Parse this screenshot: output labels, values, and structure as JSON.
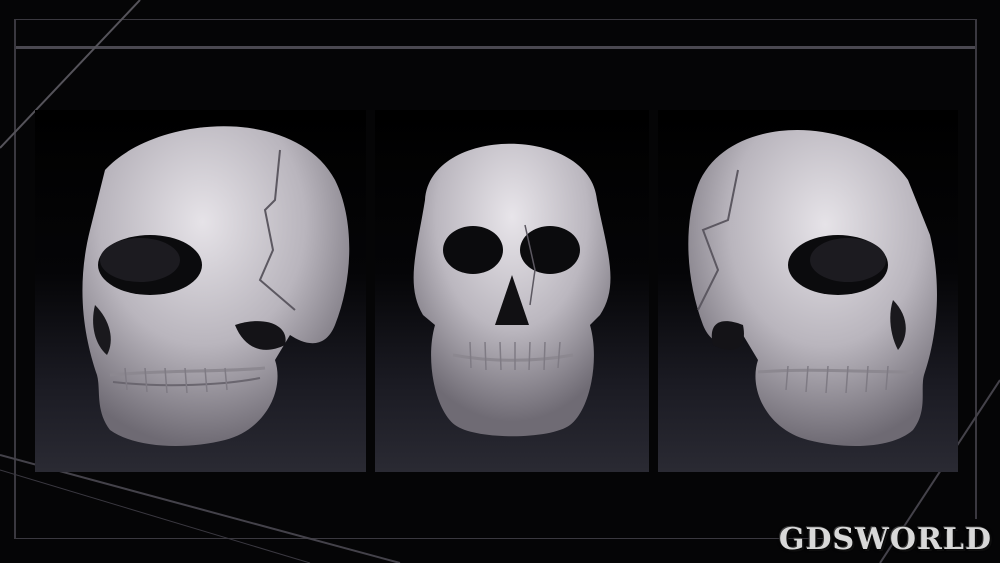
{
  "watermark": {
    "text": "GDSWORLD"
  },
  "views": [
    {
      "name": "three-quarter-left"
    },
    {
      "name": "front"
    },
    {
      "name": "three-quarter-right"
    }
  ],
  "colors": {
    "background": "#050506",
    "skull": "#c9c6cc",
    "frame": "#4a4850"
  }
}
